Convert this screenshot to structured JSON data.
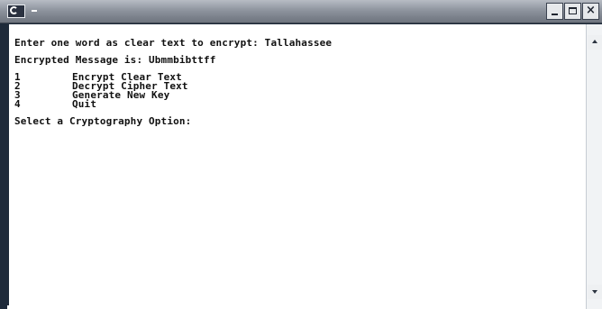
{
  "window": {
    "title": "",
    "title_icon": "console-icon",
    "controls": {
      "minimize": "-",
      "maximize": "maximize",
      "close": "×"
    }
  },
  "console": {
    "lines": [
      "Enter one word as clear text to encrypt: Tallahassee",
      "Encrypted Message is: Ubmmbibttff"
    ],
    "menu": [
      {
        "number": "1",
        "label": "Encrypt Clear Text"
      },
      {
        "number": "2",
        "label": "Decrypt Cipher Text"
      },
      {
        "number": "3",
        "label": "Generate New Key"
      },
      {
        "number": "4",
        "label": "Quit"
      }
    ],
    "prompt": "Select a Cryptography Option:"
  },
  "colors": {
    "background": "#ffffff",
    "text": "#111111",
    "frame": "#1e2a3a"
  }
}
